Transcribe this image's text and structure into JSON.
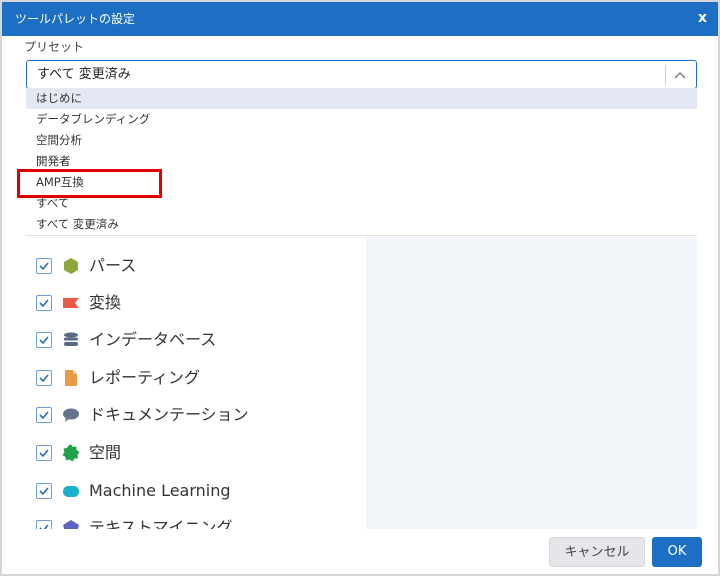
{
  "dialog": {
    "title": "ツールパレットの設定",
    "close_label": "x"
  },
  "preset": {
    "label": "プリセット",
    "selected": "すべて 変更済み",
    "options": [
      "はじめに",
      "データブレンディング",
      "空間分析",
      "開発者",
      "AMP互換",
      "すべて",
      "すべて 変更済み"
    ]
  },
  "categories": [
    {
      "label": "パース",
      "checked": true,
      "icon": "hexagon-icon",
      "color": "#8aa83c"
    },
    {
      "label": "変換",
      "checked": true,
      "icon": "flag-icon",
      "color": "#e85c45"
    },
    {
      "label": "インデータベース",
      "checked": true,
      "icon": "database-icon",
      "color": "#556b85"
    },
    {
      "label": "レポーティング",
      "checked": true,
      "icon": "document-icon",
      "color": "#e89a45"
    },
    {
      "label": "ドキュメンテーション",
      "checked": true,
      "icon": "speech-bubble-icon",
      "color": "#64748a"
    },
    {
      "label": "空間",
      "checked": true,
      "icon": "badge-icon",
      "color": "#1fa14a"
    },
    {
      "label": "Machine Learning",
      "checked": true,
      "icon": "cloud-icon",
      "color": "#19b0c9"
    },
    {
      "label": "テキストマイニング",
      "checked": true,
      "icon": "pentagon-icon",
      "color": "#5b62c4"
    }
  ],
  "buttons": {
    "cancel": "キャンセル",
    "ok": "OK"
  },
  "colors": {
    "accent": "#1d6fc4",
    "highlight": "#e00000"
  }
}
